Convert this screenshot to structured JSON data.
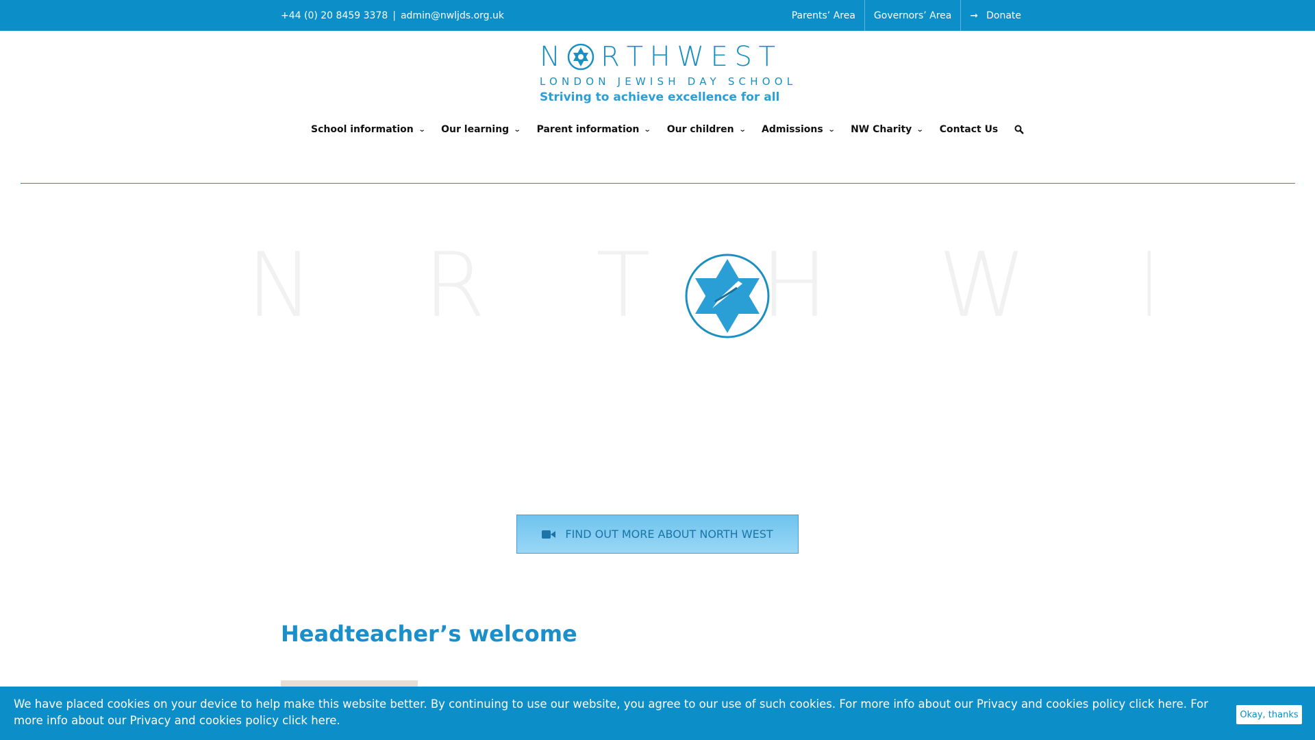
{
  "topbar": {
    "phone": "+44 (0) 20 8459 3378",
    "separator": "|",
    "email": "admin@nwljds.org.uk",
    "links": [
      "Parents’ Area",
      "Governors’ Area"
    ],
    "donate_label": "Donate",
    "color": "#0c8ec9"
  },
  "logo": {
    "letters_left": [
      "N"
    ],
    "letters_right": [
      "R",
      "T",
      "H",
      "W",
      "E",
      "S",
      "T"
    ],
    "subtitle": "LONDON JEWISH DAY SCHOOL",
    "tagline": "Striving to achieve excellence for all",
    "color": "#1a8fc0"
  },
  "nav": {
    "items": [
      {
        "label": "School information",
        "has_dropdown": true
      },
      {
        "label": "Our learning",
        "has_dropdown": true
      },
      {
        "label": "Parent information",
        "has_dropdown": true
      },
      {
        "label": "Our children",
        "has_dropdown": true
      },
      {
        "label": "Admissions",
        "has_dropdown": true
      },
      {
        "label": "NW Charity",
        "has_dropdown": true
      },
      {
        "label": "Contact Us",
        "has_dropdown": false
      }
    ],
    "search_icon": "search-icon"
  },
  "hero": {
    "faded_letters": "N R T H W E S T",
    "badge_icon": "star-of-david-icon"
  },
  "cta": {
    "label": "FIND OUT MORE ABOUT NORTH WEST",
    "icon": "video-camera-icon"
  },
  "main": {
    "heading": "Headteacher’s welcome"
  },
  "cookie": {
    "message": "We have placed cookies on your device to help make this website better. By continuing to use our website, you agree to our use of such cookies. For more info about our Privacy and cookies policy click here. For more info about our Privacy and cookies policy click here.",
    "button_label": "Okay, thanks"
  }
}
